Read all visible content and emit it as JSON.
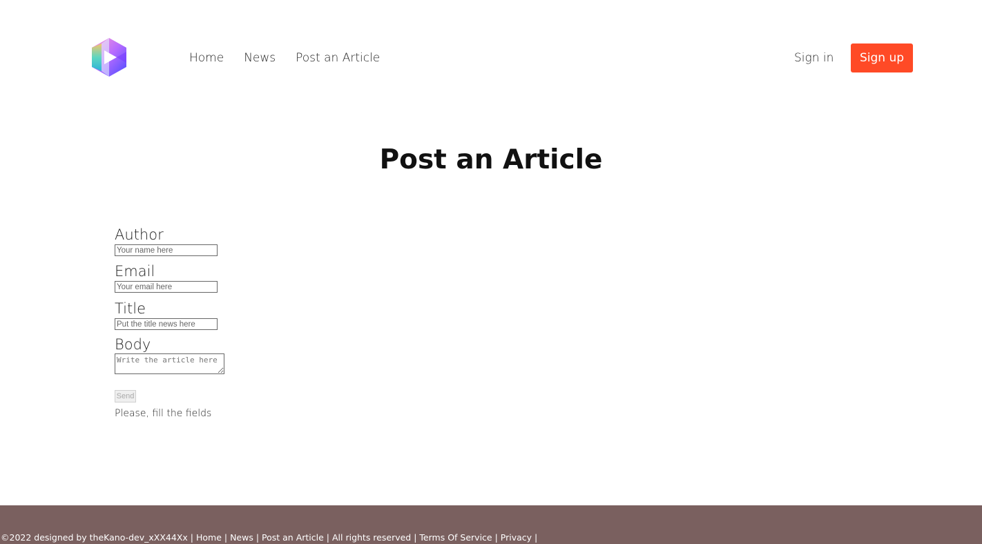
{
  "header": {
    "nav": [
      "Home",
      "News",
      "Post an Article"
    ],
    "signin_label": "Sign in",
    "signup_label": "Sign up"
  },
  "main": {
    "title": "Post an Article"
  },
  "form": {
    "author_label": "Author",
    "author_placeholder": "Your name here",
    "email_label": "Email",
    "email_placeholder": "Your email here",
    "title_label": "Title",
    "title_placeholder": "Put the title news here",
    "body_label": "Body",
    "body_placeholder": "Write the article here",
    "send_label": "Send",
    "hint": "Please, fill the fields"
  },
  "footer": {
    "copyright": "©2022 designed by theKano-dev_xXX44Xx",
    "links": [
      "Home",
      "News",
      "Post an Article"
    ],
    "rights": "All rights reserved",
    "terms": "Terms Of Service",
    "privacy": "Privacy",
    "separator": " | "
  },
  "colors": {
    "accent": "#ff4a26",
    "footer_bg": "#7a605f"
  },
  "icons": {
    "logo": "play-hexagon-logo-icon"
  }
}
